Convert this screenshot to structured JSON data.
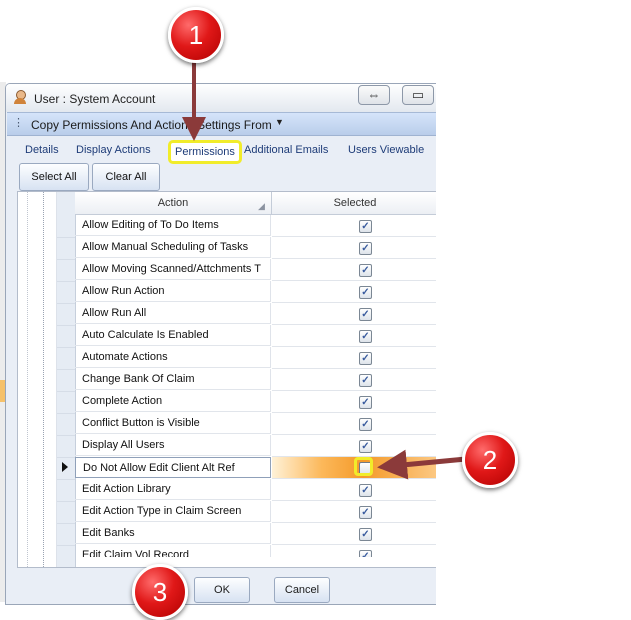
{
  "window": {
    "title": "User : System Account",
    "resize_icon": "⇔",
    "minimize_icon": "▭"
  },
  "toolbar": {
    "copy_label": "Copy Permissions And Actions Settings From",
    "dropdown_icon": "▼"
  },
  "tabs": [
    {
      "label": "Details"
    },
    {
      "label": "Display Actions"
    },
    {
      "label": "Permissions"
    },
    {
      "label": "Additional Emails"
    },
    {
      "label": "Users Viewable"
    }
  ],
  "buttons": {
    "select_all": "Select All",
    "clear_all": "Clear All",
    "ok": "OK",
    "cancel": "Cancel"
  },
  "grid": {
    "columns": {
      "action": "Action",
      "selected": "Selected"
    },
    "rows": [
      {
        "action": "Allow Editing of To Do Items",
        "selected": true
      },
      {
        "action": "Allow Manual Scheduling of Tasks",
        "selected": true
      },
      {
        "action": "Allow Moving Scanned/Attchments T",
        "selected": true
      },
      {
        "action": "Allow Run Action",
        "selected": true
      },
      {
        "action": "Allow Run All",
        "selected": true
      },
      {
        "action": "Auto Calculate Is Enabled",
        "selected": true
      },
      {
        "action": "Automate Actions",
        "selected": true
      },
      {
        "action": "Change Bank Of Claim",
        "selected": true
      },
      {
        "action": "Complete Action",
        "selected": true
      },
      {
        "action": "Conflict Button is Visible",
        "selected": true
      },
      {
        "action": "Display All Users",
        "selected": true
      },
      {
        "action": "Do Not Allow Edit Client Alt Ref",
        "selected": false,
        "current": true
      },
      {
        "action": "Edit Action Library",
        "selected": true
      },
      {
        "action": "Edit Action Type in Claim Screen",
        "selected": true
      },
      {
        "action": "Edit Banks",
        "selected": true
      },
      {
        "action": "Edit Claim Vol Record",
        "selected": true
      }
    ]
  },
  "callouts": {
    "one": "1",
    "two": "2",
    "three": "3"
  },
  "colors": {
    "highlight": "#f1ec2a",
    "badge": "#e01818",
    "arrow": "#8b3a3a"
  }
}
